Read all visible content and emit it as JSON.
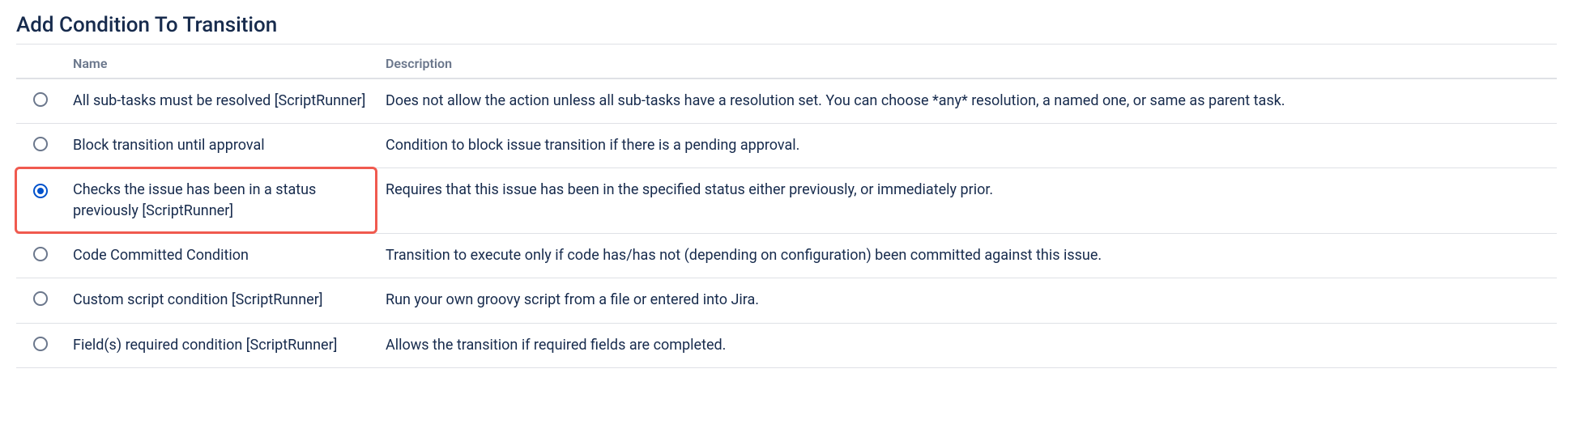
{
  "page": {
    "title": "Add Condition To Transition"
  },
  "table": {
    "headers": {
      "name": "Name",
      "description": "Description"
    },
    "rows": [
      {
        "selected": false,
        "name": "All sub-tasks must be resolved [ScriptRunner]",
        "description": "Does not allow the action unless all sub-tasks have a resolution set. You can choose *any* resolution, a named one, or same as parent task."
      },
      {
        "selected": false,
        "name": "Block transition until approval",
        "description": "Condition to block issue transition if there is a pending approval."
      },
      {
        "selected": true,
        "name": "Checks the issue has been in a status previously [ScriptRunner]",
        "description": "Requires that this issue has been in the specified status either previously, or immediately prior."
      },
      {
        "selected": false,
        "name": "Code Committed Condition",
        "description": "Transition to execute only if code has/has not (depending on configuration) been committed against this issue."
      },
      {
        "selected": false,
        "name": "Custom script condition [ScriptRunner]",
        "description": "Run your own groovy script from a file or entered into Jira."
      },
      {
        "selected": false,
        "name": "Field(s) required condition [ScriptRunner]",
        "description": "Allows the transition if required fields are completed."
      }
    ]
  },
  "highlight": {
    "row_index": 2,
    "color": "#F05A4F"
  }
}
